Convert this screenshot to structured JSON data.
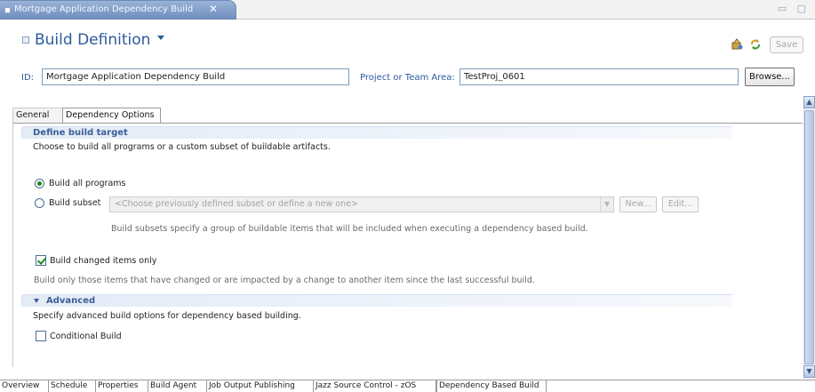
{
  "editor_tab": {
    "title": "Mortgage Application Dependency Build",
    "close_symbol": "✕"
  },
  "window_controls": "▭ ▢",
  "header": {
    "title": "Build Definition",
    "save_label": "Save"
  },
  "fields": {
    "id_label": "ID:",
    "id_value": "Mortgage Application Dependency Build",
    "project_label": "Project or Team Area:",
    "project_value": "TestProj_0601",
    "browse_label": "Browse..."
  },
  "section_tabs": [
    {
      "label": "General",
      "active": false
    },
    {
      "label": "Dependency Options",
      "active": true
    }
  ],
  "define_target": {
    "title": "Define build target",
    "description": "Choose to build all programs or a custom subset of buildable artifacts.",
    "build_all_label": "Build all programs",
    "build_all_selected": true,
    "build_subset_label": "Build subset",
    "build_subset_selected": false,
    "subset_placeholder": "<Choose previously defined subset or define a new one>",
    "new_label": "New...",
    "edit_label": "Edit...",
    "subset_hint": "Build subsets specify a group of buildable items that will be included when executing a dependency based build.",
    "changed_only_label": "Build changed items only",
    "changed_only_checked": true,
    "changed_only_hint": "Build only those items that have changed or are impacted by a change to another item since the last successful build."
  },
  "advanced": {
    "title": "Advanced",
    "description": "Specify advanced build options for dependency based building.",
    "conditional_label": "Conditional Build",
    "conditional_checked": false
  },
  "bottom_tabs": [
    {
      "label": "Overview",
      "active": false
    },
    {
      "label": "Schedule",
      "active": false
    },
    {
      "label": "Properties",
      "active": false
    },
    {
      "label": "Build Agent",
      "active": false
    },
    {
      "label": "Job Output Publishing",
      "active": false
    },
    {
      "label": "Jazz Source Control - zOS",
      "active": false
    },
    {
      "label": "Dependency Based Build",
      "active": true
    }
  ],
  "colors": {
    "accent": "#2e5a9c",
    "section_title": "#3b5f96",
    "tab_active": "#6f8fbf"
  }
}
